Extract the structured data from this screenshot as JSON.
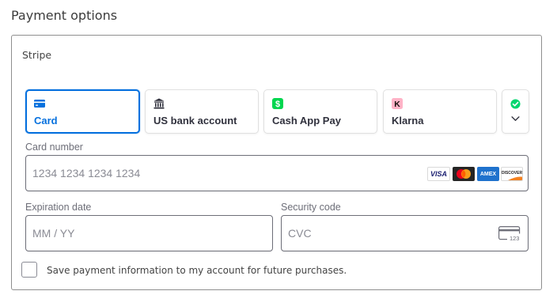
{
  "page": {
    "title": "Payment options"
  },
  "panel": {
    "title": "Stripe"
  },
  "payment_methods": [
    {
      "label": "Card",
      "icon": "card-icon",
      "selected": true
    },
    {
      "label": "US bank account",
      "icon": "bank-icon",
      "selected": false
    },
    {
      "label": "Cash App Pay",
      "icon": "cash-app-icon",
      "selected": false
    },
    {
      "label": "Klarna",
      "icon": "klarna-icon",
      "selected": false
    },
    {
      "label": "",
      "icon": "link-icon",
      "selected": false
    }
  ],
  "card_number": {
    "label": "Card number",
    "placeholder": "1234 1234 1234 1234",
    "value": "",
    "brands": [
      "VISA",
      "mastercard",
      "AMEX",
      "DISCOVER"
    ]
  },
  "expiration": {
    "label": "Expiration date",
    "placeholder": "MM / YY",
    "value": ""
  },
  "security_code": {
    "label": "Security code",
    "placeholder": "CVC",
    "value": "",
    "icon_text": "123"
  },
  "save_info": {
    "label": "Save payment information to my account for future purchases.",
    "checked": false
  },
  "colors": {
    "accent": "#0570de",
    "cash_app": "#00d64f",
    "klarna": "#ffb3c7",
    "link": "#00d66f",
    "visa_blue": "#1a1f71",
    "amex_blue": "#1f72cd",
    "discover_orange": "#f48120"
  }
}
